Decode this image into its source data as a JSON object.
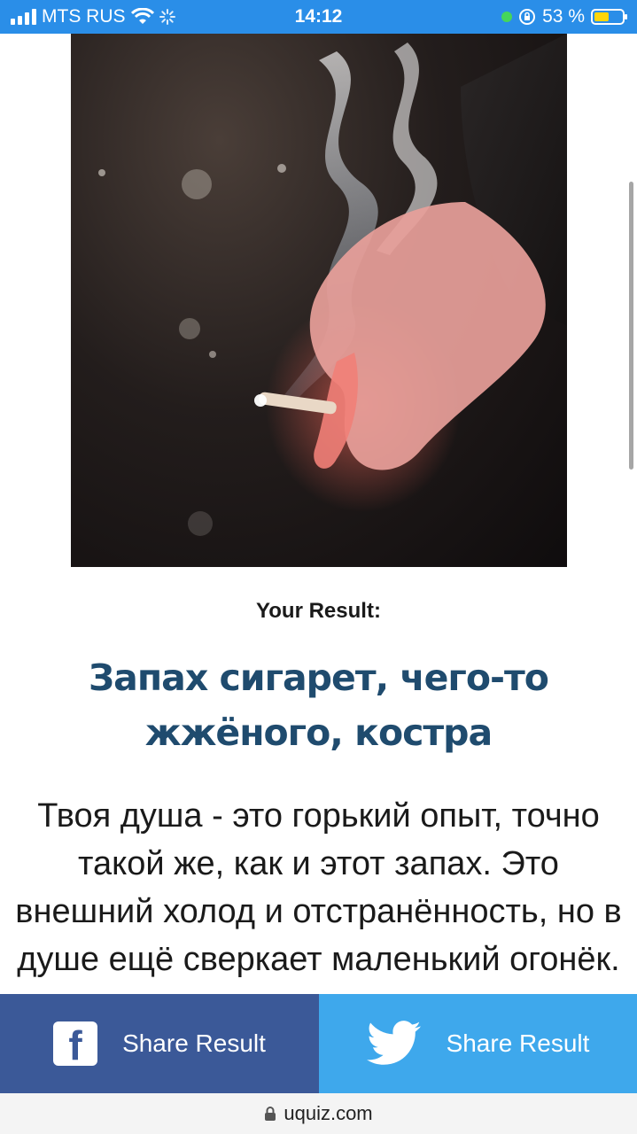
{
  "status_bar": {
    "carrier": "MTS RUS",
    "time": "14:12",
    "battery_percent": "53 %",
    "battery_level": 0.53,
    "icons": [
      "signal-icon",
      "wifi-icon",
      "loading-icon",
      "location-dot-icon",
      "rotation-lock-icon",
      "battery-icon"
    ]
  },
  "result": {
    "label": "Your Result:",
    "title": "Запах сигарет, чего-то жжёного, костра",
    "description": "Твоя душа - это горький опыт, точно такой же, как и этот запах. Это внешний холод и отстранённость, но в душе ещё сверкает маленький огонёк. Это"
  },
  "share": {
    "facebook_label": "Share Result",
    "twitter_label": "Share Result"
  },
  "browser": {
    "url": "uquiz.com"
  },
  "colors": {
    "status_bar": "#2a8ee8",
    "title": "#1f4b6e",
    "facebook": "#3b5998",
    "twitter": "#3ea8ec"
  }
}
